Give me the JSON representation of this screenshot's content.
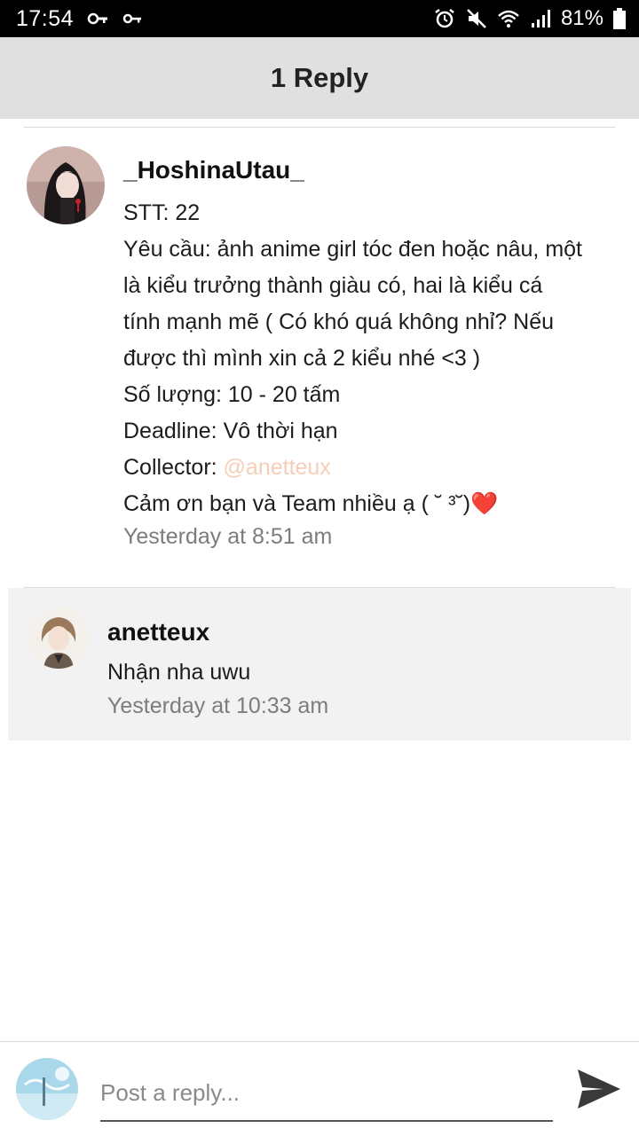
{
  "status_bar": {
    "time": "17:54",
    "battery": "81%",
    "left_icons": [
      "key-icon",
      "vpn-key-icon"
    ],
    "right_icons": [
      "alarm-icon",
      "mute-icon",
      "wifi-icon",
      "signal-icon",
      "battery-icon"
    ]
  },
  "header": {
    "title": "1 Reply"
  },
  "parent_comment": {
    "username": "_HoshinaUtau_",
    "lines": [
      "STT: 22",
      "Yêu cầu: ảnh anime girl tóc đen hoặc nâu, một",
      "là kiểu trưởng thành giàu có, hai là kiểu cá",
      "tính mạnh mẽ ( Có khó quá không nhỉ? Nếu",
      "được thì mình xin cả 2 kiểu nhé <3 )",
      "Số lượng: 10 - 20 tấm",
      "Deadline: Vô thời hạn"
    ],
    "collector_label": "Collector: ",
    "collector_mention": "@anetteux",
    "thanks": "Cảm ơn bạn và Team nhiều ạ ( ˘ ³˘)",
    "heart": "❤️",
    "timestamp": "Yesterday at 8:51 am"
  },
  "reply": {
    "username": "anetteux",
    "text": "Nhận nha uwu",
    "timestamp": "Yesterday at 10:33 am"
  },
  "composer": {
    "placeholder": "Post a reply...",
    "send_icon": "send-icon"
  },
  "colors": {
    "header_bg": "#e0e0e0",
    "mention": "#f6cdb8",
    "reply_bg": "#f2f2f2",
    "heart": "#e0262f"
  }
}
